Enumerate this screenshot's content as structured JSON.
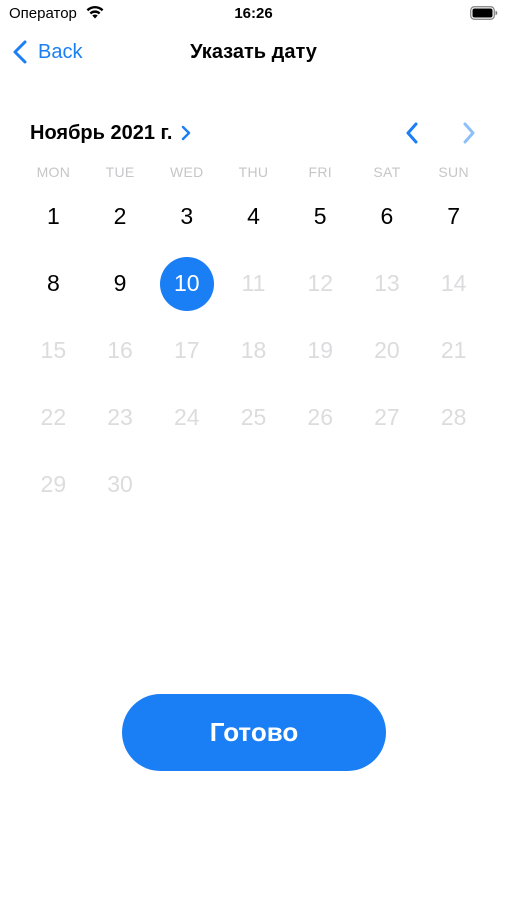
{
  "status_bar": {
    "carrier": "Оператор",
    "time": "16:26"
  },
  "nav": {
    "back_label": "Back",
    "title": "Указать дату"
  },
  "calendar": {
    "month_label": "Ноябрь 2021 г.",
    "weekdays": [
      "MON",
      "TUE",
      "WED",
      "THU",
      "FRI",
      "SAT",
      "SUN"
    ],
    "days": [
      {
        "label": "1",
        "state": "available"
      },
      {
        "label": "2",
        "state": "available"
      },
      {
        "label": "3",
        "state": "available"
      },
      {
        "label": "4",
        "state": "available"
      },
      {
        "label": "5",
        "state": "available"
      },
      {
        "label": "6",
        "state": "available"
      },
      {
        "label": "7",
        "state": "available"
      },
      {
        "label": "8",
        "state": "available"
      },
      {
        "label": "9",
        "state": "available"
      },
      {
        "label": "10",
        "state": "selected"
      },
      {
        "label": "11",
        "state": "disabled"
      },
      {
        "label": "12",
        "state": "disabled"
      },
      {
        "label": "13",
        "state": "disabled"
      },
      {
        "label": "14",
        "state": "disabled"
      },
      {
        "label": "15",
        "state": "disabled"
      },
      {
        "label": "16",
        "state": "disabled"
      },
      {
        "label": "17",
        "state": "disabled"
      },
      {
        "label": "18",
        "state": "disabled"
      },
      {
        "label": "19",
        "state": "disabled"
      },
      {
        "label": "20",
        "state": "disabled"
      },
      {
        "label": "21",
        "state": "disabled"
      },
      {
        "label": "22",
        "state": "disabled"
      },
      {
        "label": "23",
        "state": "disabled"
      },
      {
        "label": "24",
        "state": "disabled"
      },
      {
        "label": "25",
        "state": "disabled"
      },
      {
        "label": "26",
        "state": "disabled"
      },
      {
        "label": "27",
        "state": "disabled"
      },
      {
        "label": "28",
        "state": "disabled"
      },
      {
        "label": "29",
        "state": "disabled"
      },
      {
        "label": "30",
        "state": "disabled"
      }
    ]
  },
  "done_label": "Готово",
  "colors": {
    "accent": "#1a7ef5",
    "accent_light": "#8cc0fa",
    "disabled_text": "#dcdcde",
    "weekday_text": "#c6c6c8"
  },
  "icons": {
    "wifi": "wifi-icon",
    "battery": "battery-icon",
    "back": "chevron-left-icon",
    "month": "chevron-right-icon",
    "prev": "chevron-left-icon",
    "next": "chevron-right-icon"
  }
}
